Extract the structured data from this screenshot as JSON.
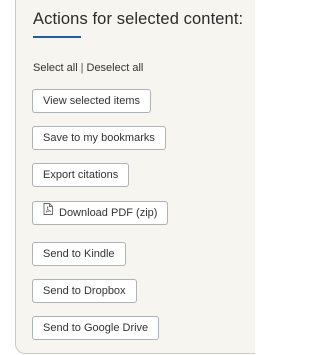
{
  "panel": {
    "title": "Actions for selected content:",
    "select_all": "Select all",
    "separator": "|",
    "deselect_all": "Deselect all"
  },
  "buttons": {
    "view_selected": "View selected items",
    "save_bookmarks": "Save to my bookmarks",
    "export_citations": "Export citations",
    "download_pdf": "Download PDF (zip)",
    "send_kindle": "Send to Kindle",
    "send_dropbox": "Send to Dropbox",
    "send_google_drive": "Send to Google Drive"
  },
  "icons": {
    "download_pdf": "pdf-file-icon"
  },
  "colors": {
    "accent": "#1f5fa0",
    "panel_background": "#f6f5ef",
    "panel_border": "#cfcbc0",
    "button_border": "#aeb3b8"
  }
}
